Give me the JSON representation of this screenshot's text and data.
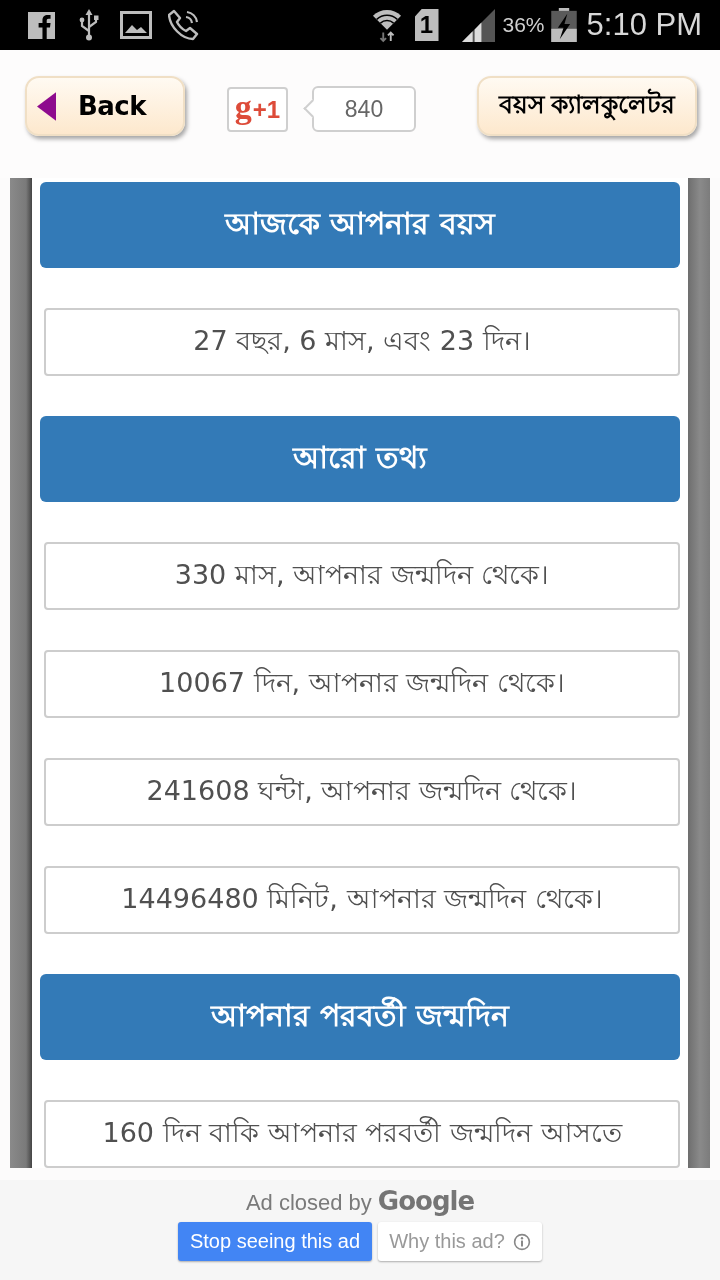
{
  "status_bar": {
    "sim_slot": "1",
    "battery": "36%",
    "time": "5:10 PM"
  },
  "header": {
    "back_button": "Back",
    "plus_one": {
      "logo": "g",
      "label": "+1",
      "count": "840"
    },
    "title_button": "বয়স ক্যালকুলেটর"
  },
  "sections": [
    {
      "heading": "আজকে আপনার বয়স",
      "items": [
        "27 বছর, 6 মাস, এবং 23 দিন।"
      ]
    },
    {
      "heading": "আরো তথ্য",
      "items": [
        "330 মাস, আপনার জন্মদিন থেকে।",
        "10067 দিন, আপনার জন্মদিন থেকে।",
        "241608 ঘন্টা, আপনার জন্মদিন থেকে।",
        "14496480 মিনিট, আপনার জন্মদিন থেকে।"
      ]
    },
    {
      "heading": "আপনার পরবর্তী জন্মদিন",
      "items": [
        "160 দিন বাকি আপনার পরবর্তী জন্মদিন আসতে"
      ]
    }
  ],
  "ad_notice": {
    "text": "Ad closed by",
    "brand": "Google",
    "buttons": [
      {
        "kind": "primary",
        "label": "Stop seeing this ad"
      },
      {
        "kind": "secondary",
        "label": "Why this ad?"
      }
    ]
  }
}
